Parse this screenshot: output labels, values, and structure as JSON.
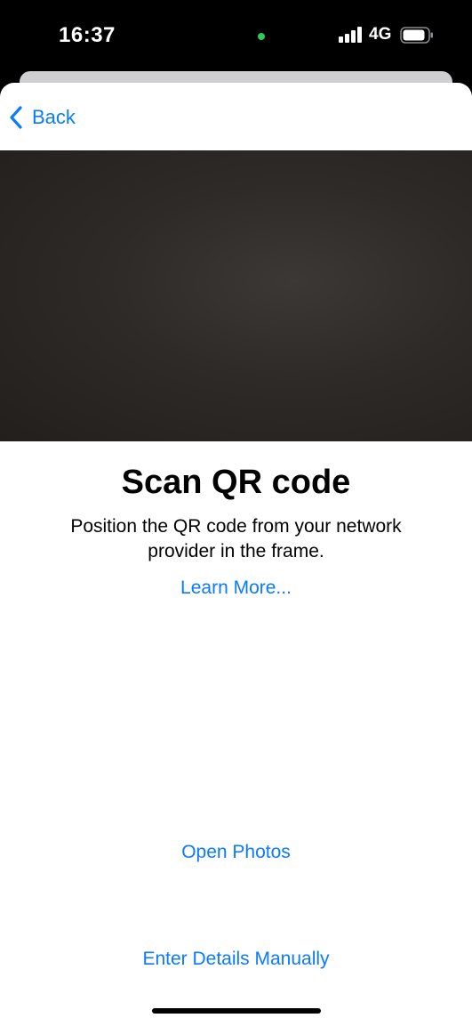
{
  "status_bar": {
    "time": "16:37",
    "network": "4G",
    "mic_indicator_color": "#34c759",
    "signal_icon": "cellular-signal-icon",
    "battery_icon": "battery-icon"
  },
  "nav": {
    "back_label": "Back",
    "back_icon": "chevron-left-icon"
  },
  "content": {
    "title": "Scan QR code",
    "subtitle": "Position the QR code from your network provider in the frame.",
    "learn_more": "Learn More...",
    "open_photos": "Open Photos",
    "enter_manually": "Enter Details Manually"
  },
  "colors": {
    "accent": "#0a7aff",
    "camera_bg": "#2d2a27"
  }
}
